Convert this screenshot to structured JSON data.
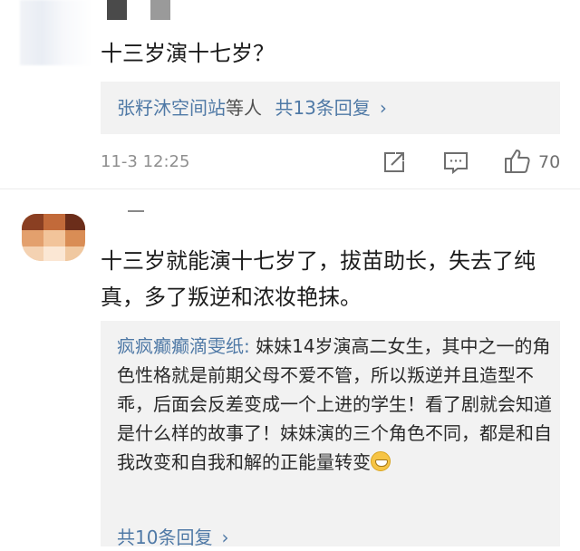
{
  "comments": [
    {
      "text": "十三岁演十七岁？",
      "reply_preview": {
        "names": "张籽沐空间站",
        "suffix": "等人",
        "count_label": "共13条回复",
        "chevron": "›"
      },
      "timestamp": "11-3 12:25",
      "likes": "70"
    },
    {
      "text": "十三岁就能演十七岁了，拔苗助长，失去了纯真，多了叛逆和浓妆艳抹。",
      "reply": {
        "author": "疯疯癫癫滴雯纸:",
        "text": " 妹妹14岁演高二女生，其中之一的角色性格就是前期父母不爱不管，所以叛逆并且造型不乖，后面会反差变成一个上进的学生！看了剧就会知道是什么样的故事了！妹妹演的三个角色不同，都是和自我改变和自我和解的正能量转变",
        "emoji": "grin-emoji"
      },
      "more_label": "共10条回复",
      "chevron": "›"
    }
  ],
  "icons": {
    "share": "share-icon",
    "comment": "comment-icon",
    "like": "thumbs-up-icon"
  },
  "colors": {
    "link": "#4f79a6",
    "reply_bg": "#f2f2f2",
    "meta": "#8f8f8f"
  }
}
